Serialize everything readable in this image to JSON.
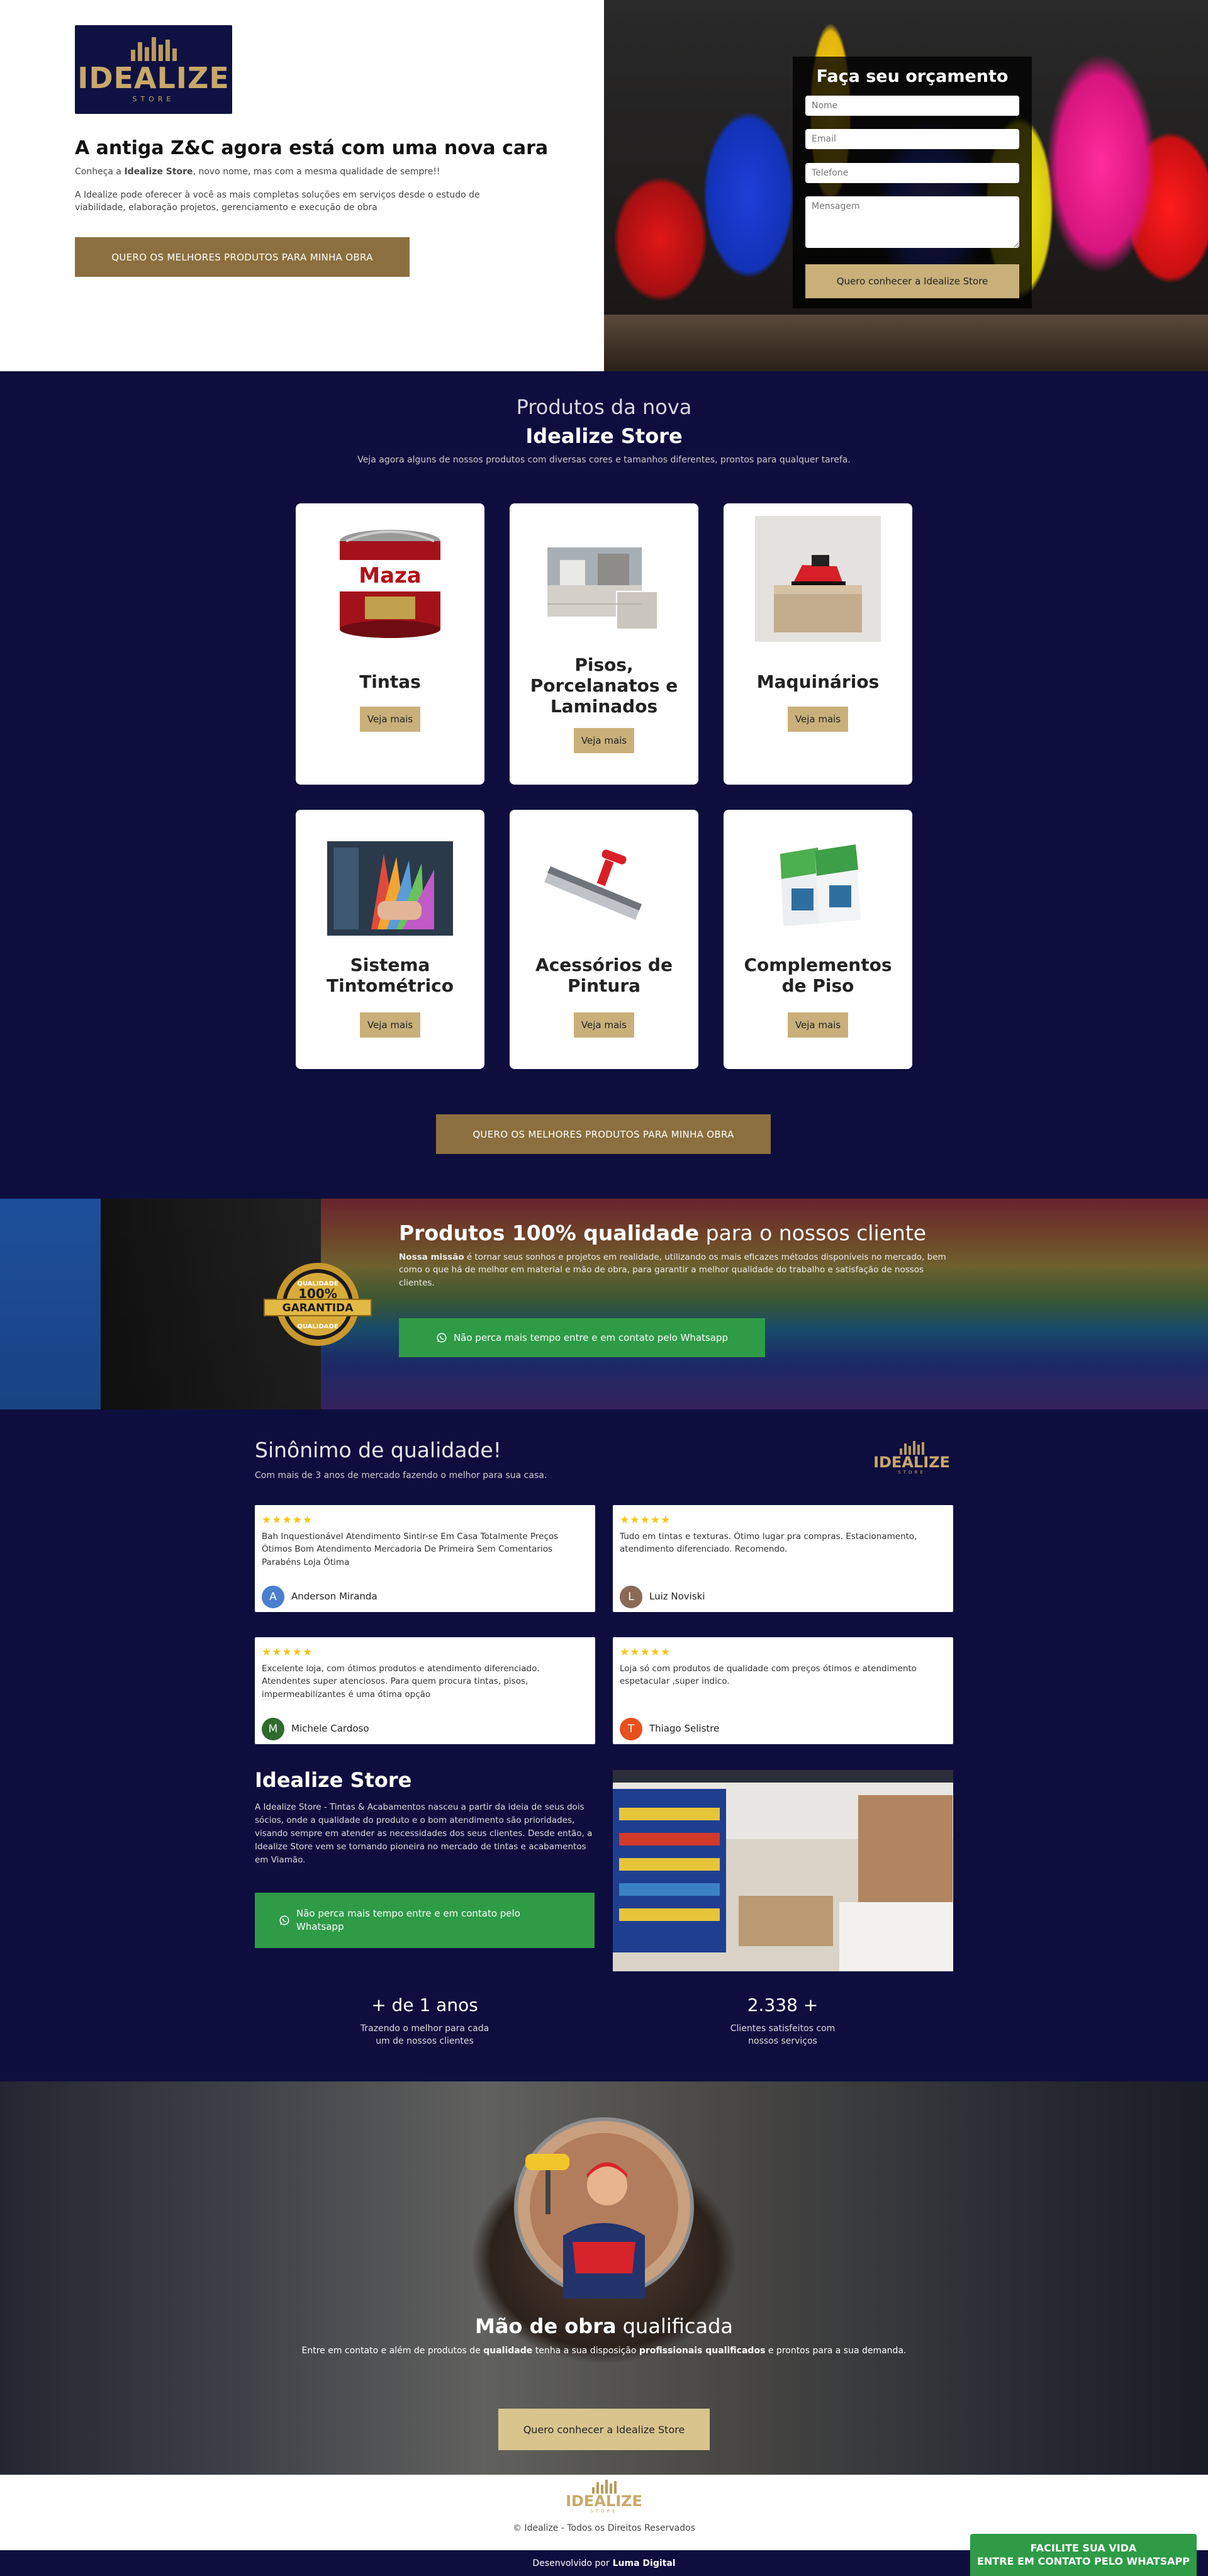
{
  "hero": {
    "logo_word": "IDEALIZE",
    "logo_sub": "STORE",
    "title": "A antiga Z&C agora está com uma nova cara",
    "intro_prefix": "Conheça a ",
    "intro_brand": "Idealize Store",
    "intro_suffix": ", novo nome, mas com a mesma qualidade de sempre!!",
    "description": "A Idealize pode oferecer à você as mais completas soluções em serviços desde o estudo de viabilidade, elaboração projetos, gerenciamento e execução de obra",
    "cta": "QUERO OS MELHORES PRODUTOS PARA MINHA OBRA"
  },
  "form": {
    "title": "Faça seu orçamento",
    "name_placeholder": "Nome",
    "email_placeholder": "Email",
    "phone_placeholder": "Telefone",
    "message_placeholder": "Mensagem",
    "submit": "Quero conhecer a Idealize Store"
  },
  "products": {
    "heading_line1": "Produtos da nova",
    "heading_line2": "Idealize Store",
    "subtitle": "Veja agora alguns de nossos produtos com diversas cores e tamanhos diferentes, prontos para qualquer tarefa.",
    "more_label": "Veja mais",
    "items": [
      {
        "name": "Tintas",
        "image_label": "Maza"
      },
      {
        "name": "Pisos, Porcelanatos e Laminados"
      },
      {
        "name": "Maquinários"
      },
      {
        "name": "Sistema Tintométrico"
      },
      {
        "name": "Acessórios de Pintura"
      },
      {
        "name": "Complementos de Piso"
      }
    ],
    "cta": "QUERO OS MELHORES PRODUTOS PARA MINHA OBRA"
  },
  "quality": {
    "title_bold": "Produtos 100% qualidade",
    "title_rest": " para o nossos cliente",
    "mission_label": "Nossa missão",
    "mission_text": " é tornar seus sonhos e projetos em realidade, utilizando os mais eficazes métodos disponíveis no mercado, bem como o que há de melhor em material e mão de obra, para garantir a melhor qualidade do trabalho e satisfação de nossos clientes.",
    "seal_top": "QUALIDADE",
    "seal_mid": "100%",
    "seal_word": "GARANTIDA",
    "seal_bottom": "QUALIDADE",
    "whatsapp_cta": "Não perca mais tempo entre e em contato pelo Whatsapp"
  },
  "reviews": {
    "heading": "Sinônimo de qualidade!",
    "subtitle": "Com mais de 3 anos de mercado fazendo o melhor para sua casa.",
    "stars": "★★★★★",
    "items": [
      {
        "text": "Bah Inquestionável Atendimento Sintir-se Em Casa Totalmente Preços Ótimos Bom Atendimento Mercadoria De Primeira Sem Comentarios Parabéns Loja Ótima",
        "author": "Anderson Miranda",
        "initial": "A",
        "color": "#4a7fd0"
      },
      {
        "text": "Tudo em tintas e texturas. Ótimo lugar pra compras. Estacionamento, atendimento diferenciado. Recomendo.",
        "author": "Luiz Noviski",
        "initial": "L",
        "color": "#8a6a55"
      },
      {
        "text": "Excelente loja, com ótimos produtos e atendimento diferenciado. Atendentes super atenciosos. Para quem procura tintas, pisos, impermeabilizantes é uma ótima opção",
        "author": "Michele Cardoso",
        "initial": "M",
        "color": "#2f6b2f"
      },
      {
        "text": "Loja só com produtos de qualidade com preços ótimos e atendimento espetacular ,super indico.",
        "author": "Thiago Selistre",
        "initial": "T",
        "color": "#e8501e"
      }
    ]
  },
  "about": {
    "heading": "Idealize Store",
    "text": "A Idealize Store - Tintas & Acabamentos nasceu a partir da ideia de seus dois sócios, onde a qualidade do produto e o bom atendimento são prioridades, visando sempre em atender as necessidades dos seus clientes. Desde então, a Idealize Store vem se tornando pioneira no mercado de tintas e acabamentos em Viamão.",
    "whatsapp_cta": "Não perca mais tempo entre e em contato pelo Whatsapp",
    "stats": [
      {
        "number": "+ de 1 anos",
        "label_line1": "Trazendo o melhor para cada",
        "label_line2": "um de nossos clientes"
      },
      {
        "number": "2.338 +",
        "label_line1": "Clientes satisfeitos com",
        "label_line2": "nossos serviços"
      }
    ]
  },
  "labor": {
    "title_bold": "Mão de obra",
    "title_rest": " qualificada",
    "p_a": "Entre em contato e além de produtos de ",
    "p_b": "qualidade",
    "p_c": " tenha a sua disposição ",
    "p_d": "profissionais qualificados",
    "p_e": " e prontos para a sua demanda.",
    "cta": "Quero conhecer a Idealize Store"
  },
  "footer": {
    "copyright": "© Idealize - Todos os Direitos Reservados",
    "dev_prefix": "Desenvolvido por",
    "dev_name": "Luma Digital"
  },
  "floating": {
    "line1": "FACILITE SUA VIDA",
    "line2_prefix": "ENTRE EM CONTATO PELO ",
    "line2_brand": "WHATSAPP"
  },
  "colors": {
    "navy": "#0d0e3e",
    "gold": "#8b6f3e",
    "light_gold": "#c9b07a",
    "green": "#2e9b46"
  }
}
